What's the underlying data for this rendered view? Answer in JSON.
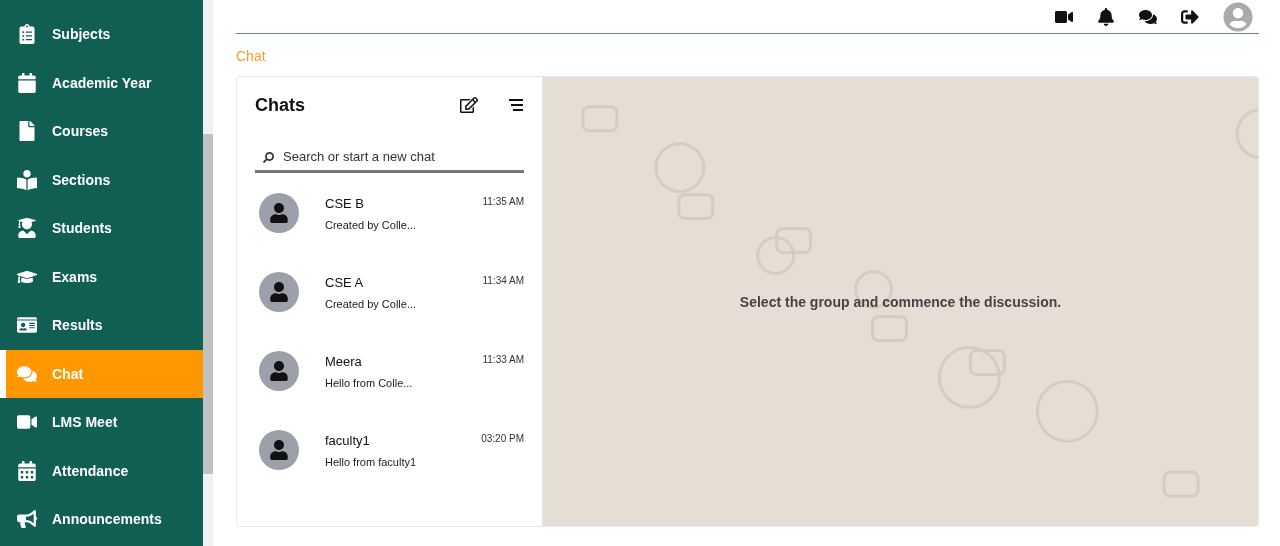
{
  "sidebar": {
    "items": [
      {
        "label": "Subjects",
        "selected": false
      },
      {
        "label": "Academic Year",
        "selected": false
      },
      {
        "label": "Courses",
        "selected": false
      },
      {
        "label": "Sections",
        "selected": false
      },
      {
        "label": "Students",
        "selected": false
      },
      {
        "label": "Exams",
        "selected": false
      },
      {
        "label": "Results",
        "selected": false
      },
      {
        "label": "Chat",
        "selected": true
      },
      {
        "label": "LMS Meet",
        "selected": false
      },
      {
        "label": "Attendance",
        "selected": false
      },
      {
        "label": "Announcements",
        "selected": false
      }
    ]
  },
  "breadcrumb": "Chat",
  "chats_panel": {
    "title": "Chats",
    "search": {
      "placeholder": "Search or start a new chat"
    },
    "conversations": [
      {
        "name": "CSE B",
        "time": "11:35 AM",
        "preview": "Created by Colle..."
      },
      {
        "name": "CSE A",
        "time": "11:34 AM",
        "preview": "Created by Colle..."
      },
      {
        "name": "Meera",
        "time": "11:33 AM",
        "preview": "Hello from Colle..."
      },
      {
        "name": "faculty1",
        "time": "03:20 PM",
        "preview": "Hello from faculty1"
      }
    ]
  },
  "empty_state": "Select the group and commence the discussion."
}
